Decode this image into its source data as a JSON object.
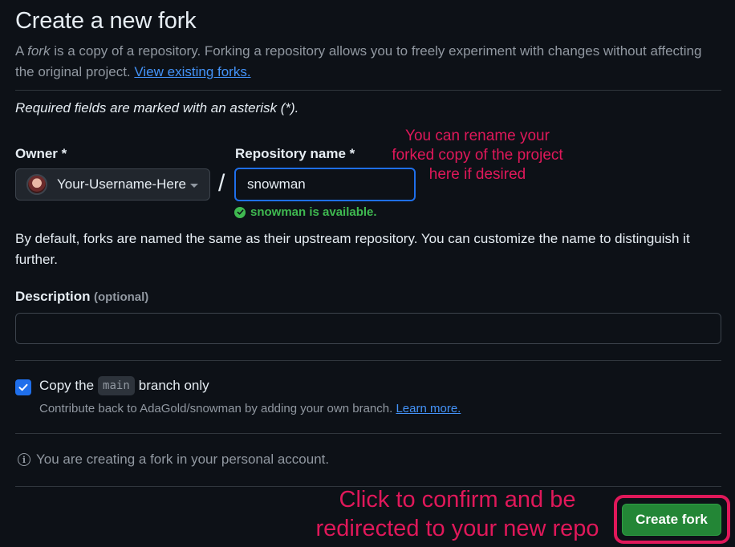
{
  "page": {
    "title": "Create a new fork",
    "intro_prefix": "A ",
    "intro_em": "fork",
    "intro_text": " is a copy of a repository. Forking a repository allows you to freely experiment with changes without affecting the original project. ",
    "intro_link": "View existing forks.",
    "required_note": "Required fields are marked with an asterisk (*)."
  },
  "owner": {
    "label": "Owner *",
    "selected": "Your-Username-Here"
  },
  "separator": "/",
  "repo_name": {
    "label": "Repository name *",
    "value": "snowman",
    "availability": "snowman is available."
  },
  "default_note": "By default, forks are named the same as their upstream repository. You can customize the name to distinguish it further.",
  "description": {
    "label": "Description",
    "optional": "(optional)",
    "value": ""
  },
  "copy_branch": {
    "checked": true,
    "prefix": "Copy the",
    "branch": "main",
    "suffix": "branch only",
    "help_text": "Contribute back to AdaGold/snowman by adding your own branch.",
    "help_link": "Learn more."
  },
  "info": "You are creating a fork in your personal account.",
  "create_button": "Create fork",
  "annotations": {
    "rename_note": "You can rename your forked copy of the project here if desired",
    "confirm_note": "Click to confirm and be redirected to your new repo",
    "color": "#e0185a"
  },
  "colors": {
    "background": "#0d1117",
    "link": "#4493f8",
    "success": "#3fb950",
    "primary_button": "#238636",
    "focus_border": "#1f6feb"
  }
}
